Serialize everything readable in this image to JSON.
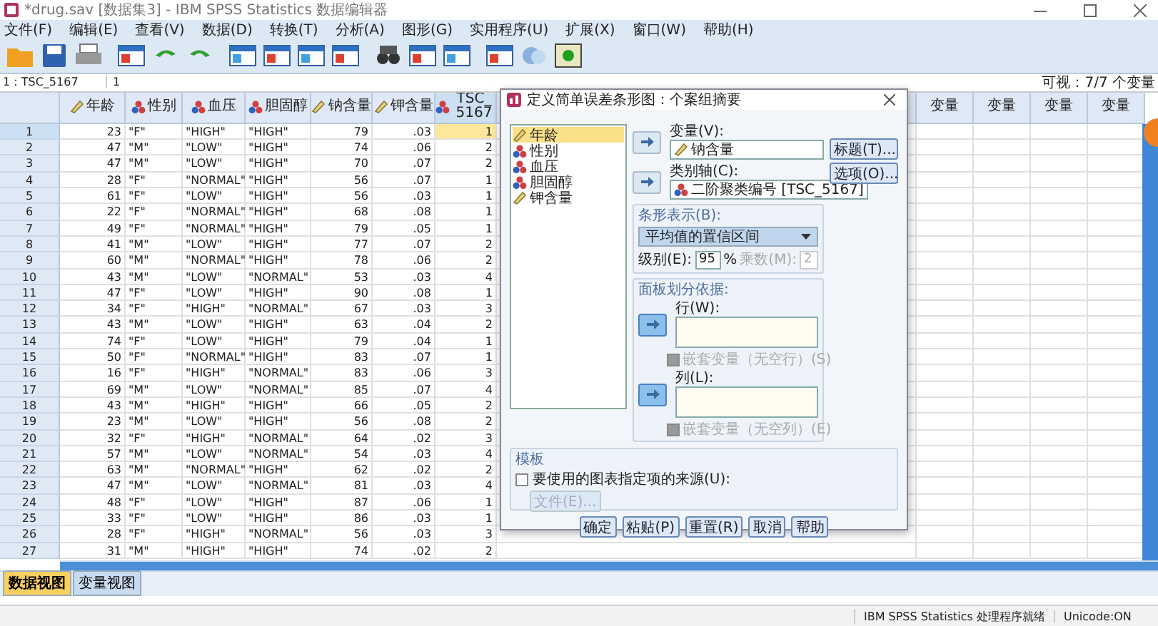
{
  "window": {
    "title": "*drug.sav [数据集3] - IBM SPSS Statistics 数据编辑器"
  },
  "menu": [
    "文件(F)",
    "编辑(E)",
    "查看(V)",
    "数据(D)",
    "转换(T)",
    "分析(A)",
    "图形(G)",
    "实用程序(U)",
    "扩展(X)",
    "窗口(W)",
    "帮助(H)"
  ],
  "cell_bar": {
    "cell": "1 : TSC_5167",
    "value": "1",
    "visible": "可视：7/7 个变量"
  },
  "table": {
    "columns": [
      {
        "label": "年龄",
        "kind": "scale",
        "selected": false
      },
      {
        "label": "性别",
        "kind": "nominal",
        "selected": false
      },
      {
        "label": "血压",
        "kind": "nominal",
        "selected": false
      },
      {
        "label": "胆固醇",
        "kind": "nominal",
        "selected": false
      },
      {
        "label": "钠含量",
        "kind": "scale",
        "selected": false
      },
      {
        "label": "钾含量",
        "kind": "scale",
        "selected": false
      },
      {
        "label": "TSC_5167",
        "kind": "nominal",
        "selected": true
      }
    ],
    "empty_columns": [
      "变量",
      "变量",
      "变量",
      "变量"
    ],
    "rows": [
      {
        "n": "1",
        "selected": true,
        "cells": [
          "23",
          "\"F\"",
          "\"HIGH\"",
          "\"HIGH\"",
          "79",
          ".03",
          "1"
        ]
      },
      {
        "n": "2",
        "selected": false,
        "cells": [
          "47",
          "\"M\"",
          "\"LOW\"",
          "\"HIGH\"",
          "74",
          ".06",
          "2"
        ]
      },
      {
        "n": "3",
        "selected": false,
        "cells": [
          "47",
          "\"M\"",
          "\"LOW\"",
          "\"HIGH\"",
          "70",
          ".07",
          "2"
        ]
      },
      {
        "n": "4",
        "selected": false,
        "cells": [
          "28",
          "\"F\"",
          "\"NORMAL\"",
          "\"HIGH\"",
          "56",
          ".07",
          "1"
        ]
      },
      {
        "n": "5",
        "selected": false,
        "cells": [
          "61",
          "\"F\"",
          "\"LOW\"",
          "\"HIGH\"",
          "56",
          ".03",
          "1"
        ]
      },
      {
        "n": "6",
        "selected": false,
        "cells": [
          "22",
          "\"F\"",
          "\"NORMAL\"",
          "\"HIGH\"",
          "68",
          ".08",
          "1"
        ]
      },
      {
        "n": "7",
        "selected": false,
        "cells": [
          "49",
          "\"F\"",
          "\"NORMAL\"",
          "\"HIGH\"",
          "79",
          ".05",
          "1"
        ]
      },
      {
        "n": "8",
        "selected": false,
        "cells": [
          "41",
          "\"M\"",
          "\"LOW\"",
          "\"HIGH\"",
          "77",
          ".07",
          "2"
        ]
      },
      {
        "n": "9",
        "selected": false,
        "cells": [
          "60",
          "\"M\"",
          "\"NORMAL\"",
          "\"HIGH\"",
          "78",
          ".06",
          "2"
        ]
      },
      {
        "n": "10",
        "selected": false,
        "cells": [
          "43",
          "\"M\"",
          "\"LOW\"",
          "\"NORMAL\"",
          "53",
          ".03",
          "4"
        ]
      },
      {
        "n": "11",
        "selected": false,
        "cells": [
          "47",
          "\"F\"",
          "\"LOW\"",
          "\"HIGH\"",
          "90",
          ".08",
          "1"
        ]
      },
      {
        "n": "12",
        "selected": false,
        "cells": [
          "34",
          "\"F\"",
          "\"HIGH\"",
          "\"NORMAL\"",
          "67",
          ".03",
          "3"
        ]
      },
      {
        "n": "13",
        "selected": false,
        "cells": [
          "43",
          "\"M\"",
          "\"LOW\"",
          "\"HIGH\"",
          "63",
          ".04",
          "2"
        ]
      },
      {
        "n": "14",
        "selected": false,
        "cells": [
          "74",
          "\"F\"",
          "\"LOW\"",
          "\"HIGH\"",
          "79",
          ".04",
          "1"
        ]
      },
      {
        "n": "15",
        "selected": false,
        "cells": [
          "50",
          "\"F\"",
          "\"NORMAL\"",
          "\"HIGH\"",
          "83",
          ".07",
          "1"
        ]
      },
      {
        "n": "16",
        "selected": false,
        "cells": [
          "16",
          "\"F\"",
          "\"HIGH\"",
          "\"NORMAL\"",
          "83",
          ".06",
          "3"
        ]
      },
      {
        "n": "17",
        "selected": false,
        "cells": [
          "69",
          "\"M\"",
          "\"LOW\"",
          "\"NORMAL\"",
          "85",
          ".07",
          "4"
        ]
      },
      {
        "n": "18",
        "selected": false,
        "cells": [
          "43",
          "\"M\"",
          "\"HIGH\"",
          "\"HIGH\"",
          "66",
          ".05",
          "2"
        ]
      },
      {
        "n": "19",
        "selected": false,
        "cells": [
          "23",
          "\"M\"",
          "\"LOW\"",
          "\"HIGH\"",
          "56",
          ".08",
          "2"
        ]
      },
      {
        "n": "20",
        "selected": false,
        "cells": [
          "32",
          "\"F\"",
          "\"HIGH\"",
          "\"NORMAL\"",
          "64",
          ".02",
          "3"
        ]
      },
      {
        "n": "21",
        "selected": false,
        "cells": [
          "57",
          "\"M\"",
          "\"LOW\"",
          "\"NORMAL\"",
          "54",
          ".03",
          "4"
        ]
      },
      {
        "n": "22",
        "selected": false,
        "cells": [
          "63",
          "\"M\"",
          "\"NORMAL\"",
          "\"HIGH\"",
          "62",
          ".02",
          "2"
        ]
      },
      {
        "n": "23",
        "selected": false,
        "cells": [
          "47",
          "\"M\"",
          "\"LOW\"",
          "\"NORMAL\"",
          "81",
          ".03",
          "4"
        ]
      },
      {
        "n": "24",
        "selected": false,
        "cells": [
          "48",
          "\"F\"",
          "\"LOW\"",
          "\"HIGH\"",
          "87",
          ".06",
          "1"
        ]
      },
      {
        "n": "25",
        "selected": false,
        "cells": [
          "33",
          "\"F\"",
          "\"LOW\"",
          "\"HIGH\"",
          "86",
          ".03",
          "1"
        ]
      },
      {
        "n": "26",
        "selected": false,
        "cells": [
          "28",
          "\"F\"",
          "\"HIGH\"",
          "\"NORMAL\"",
          "56",
          ".03",
          "3"
        ]
      },
      {
        "n": "27",
        "selected": false,
        "cells": [
          "31",
          "\"M\"",
          "\"HIGH\"",
          "\"HIGH\"",
          "74",
          ".02",
          "2"
        ]
      }
    ]
  },
  "view_tabs": [
    {
      "label": "数据视图",
      "selected": true
    },
    {
      "label": "变量视图",
      "selected": false
    }
  ],
  "status_bar": {
    "message": "IBM SPSS Statistics 处理程序就绪",
    "unicode": "Unicode:ON"
  },
  "dialog": {
    "title": "定义简单误差条形图：个案组摘要",
    "source_list": [
      {
        "label": "年龄",
        "kind": "scale",
        "selected": true
      },
      {
        "label": "性别",
        "kind": "nominal",
        "selected": false
      },
      {
        "label": "血压",
        "kind": "nominal",
        "selected": false
      },
      {
        "label": "胆固醇",
        "kind": "nominal",
        "selected": false
      },
      {
        "label": "钾含量",
        "kind": "scale",
        "selected": false
      }
    ],
    "variable": {
      "label": "变量(V):",
      "value": "钠含量",
      "kind": "scale"
    },
    "category_axis": {
      "label": "类别轴(C):",
      "value": "二阶聚类编号 [TSC_5167]",
      "kind": "nominal"
    },
    "side_buttons": [
      "标题(T)...",
      "选项(O)..."
    ],
    "bars_represent": {
      "label": "条形表示(B):",
      "value": "平均值的置信区间",
      "level_label": "级别(E):",
      "level_value": "95",
      "percent": "%",
      "multiplier_label": "乘数(M):",
      "multiplier_value": "2",
      "multiplier_disabled": true
    },
    "panel": {
      "label": "面板划分依据:",
      "rows_label": "行(W):",
      "rows_nest": {
        "label": "嵌套变量（无空行）(S)",
        "checked": false,
        "disabled": true
      },
      "cols_label": "列(L):",
      "cols_nest": {
        "label": "嵌套变量（无空列）(E)",
        "checked": false,
        "disabled": true
      }
    },
    "template": {
      "label": "模板",
      "use": {
        "label": "要使用的图表指定项的来源(U):",
        "checked": false,
        "disabled": false
      },
      "file_button": {
        "label": "文件(E)...",
        "disabled": true
      }
    },
    "buttons": [
      "确定",
      "粘贴(P)",
      "重置(R)",
      "取消",
      "帮助"
    ]
  }
}
